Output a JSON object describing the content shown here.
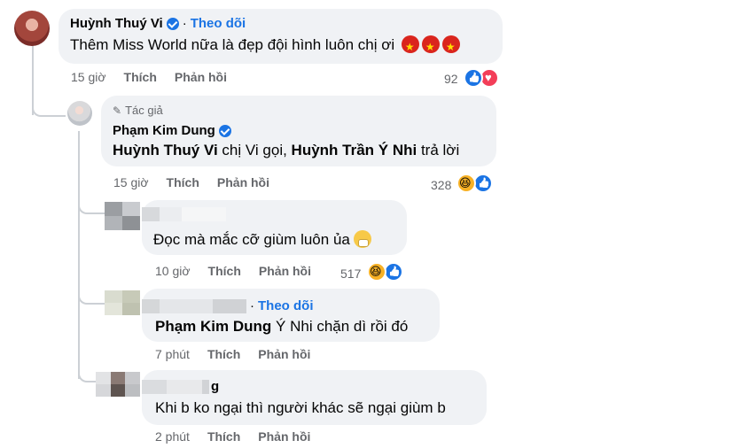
{
  "comments": [
    {
      "author": "Huỳnh Thuý Vi",
      "follow": "Theo dõi",
      "text": "Thêm Miss World nữa là đẹp đội hình luôn chị ơi",
      "time": "15 giờ",
      "like": "Thích",
      "reply": "Phản hồi",
      "reactions": "92"
    },
    {
      "badge": "Tác giả",
      "author": "Phạm Kim Dung",
      "mention1": "Huỳnh Thuý Vi",
      "text1": " chị Vi gọi, ",
      "mention2": "Huỳnh Trần Ý Nhi",
      "text2": " trả lời",
      "time": "15 giờ",
      "like": "Thích",
      "reply": "Phản hồi",
      "reactions": "328"
    },
    {
      "text": "Đọc mà mắc cỡ giùm luôn ủa",
      "time": "10 giờ",
      "like": "Thích",
      "reply": "Phản hồi",
      "reactions": "517"
    },
    {
      "follow": "Theo dõi",
      "mention": "Phạm Kim Dung",
      "text": " Ý Nhi chặn dì rồi đó",
      "time": "7 phút",
      "like": "Thích",
      "reply": "Phản hồi"
    },
    {
      "name_tail": "g",
      "text": "Khi b ko ngại thì người khác sẽ ngại giùm b",
      "time": "2 phút",
      "like": "Thích",
      "reply": "Phản hồi"
    }
  ],
  "colors": {
    "link": "#1b74e4",
    "bubble": "#f0f2f5",
    "meta": "#65676b",
    "line": "#ccd0d5"
  }
}
